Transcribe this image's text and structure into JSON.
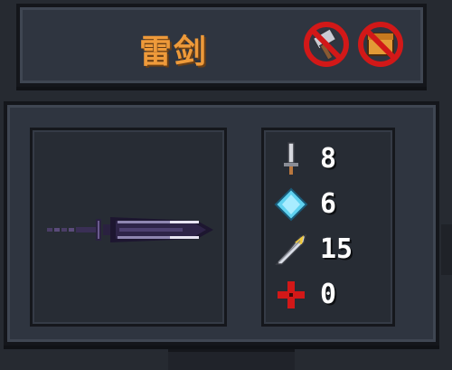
{
  "weapon": {
    "name": "雷剑"
  },
  "stats": {
    "damage": "8",
    "energy": "6",
    "crit": "15",
    "heal": "0"
  },
  "icons": {
    "no_hammer": "no-hammer-icon",
    "no_box": "no-box-icon",
    "damage": "sword-icon",
    "energy": "energy-crystal-icon",
    "crit": "crit-feather-icon",
    "heal": "red-cross-icon"
  },
  "colors": {
    "title": "#ee9a3a",
    "panel": "#2f3540",
    "stat_text": "#ffffff",
    "prohibit": "#d21818"
  }
}
